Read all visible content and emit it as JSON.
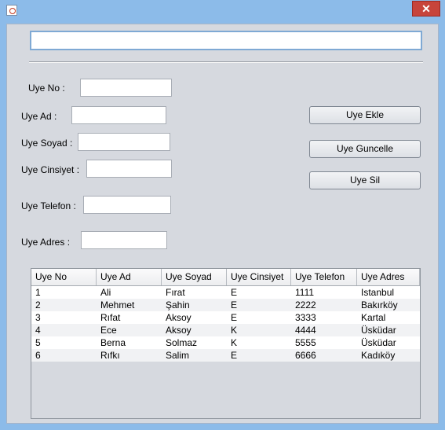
{
  "window": {
    "close_symbol": "✕"
  },
  "top_input": {
    "value": ""
  },
  "form": {
    "fields": [
      {
        "label": "Uye No :",
        "value": ""
      },
      {
        "label": "Uye Ad :",
        "value": ""
      },
      {
        "label": "Uye Soyad :",
        "value": ""
      },
      {
        "label": "Uye Cinsiyet :",
        "value": ""
      },
      {
        "label": "Uye Telefon :",
        "value": ""
      },
      {
        "label": "Uye Adres :",
        "value": ""
      }
    ]
  },
  "buttons": {
    "add": "Uye Ekle",
    "update": "Uye Guncelle",
    "delete": "Uye Sil"
  },
  "table": {
    "headers": [
      "Uye No",
      "Uye Ad",
      "Uye Soyad",
      "Uye Cinsiyet",
      "Uye Telefon",
      "Uye Adres"
    ],
    "rows": [
      [
        "1",
        "Ali",
        "Fırat",
        "E",
        "1111",
        "Istanbul"
      ],
      [
        "2",
        "Mehmet",
        "Şahin",
        "E",
        "2222",
        "Bakırköy"
      ],
      [
        "3",
        "Rıfat",
        "Aksoy",
        "E",
        "3333",
        "Kartal"
      ],
      [
        "4",
        "Ece",
        "Aksoy",
        "K",
        "4444",
        "Üsküdar"
      ],
      [
        "5",
        "Berna",
        "Solmaz",
        "K",
        "5555",
        "Üsküdar"
      ],
      [
        "6",
        "Rıfkı",
        "Salim",
        "E",
        "6666",
        "Kadıköy"
      ]
    ]
  }
}
